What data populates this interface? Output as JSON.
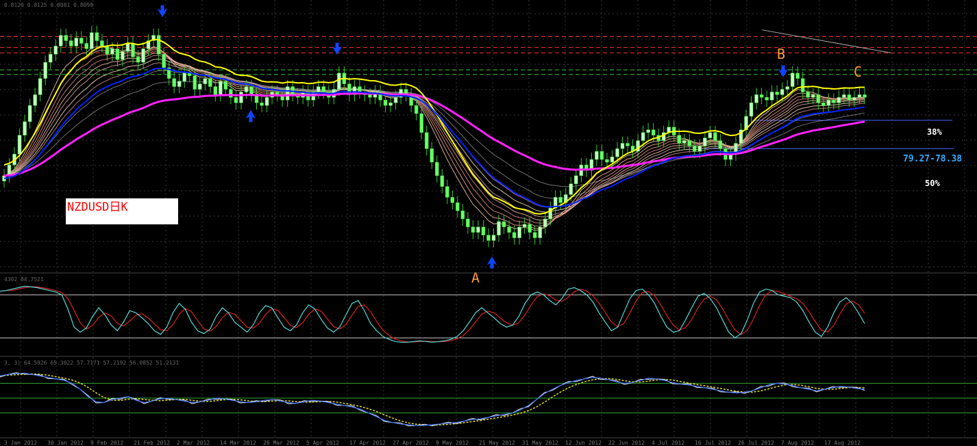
{
  "chart_data": [
    {
      "type": "candlestick",
      "symbol_label": "NZDUSD日K",
      "header_text": "0.8120 0.8125 0.8081 0.8098",
      "x_tick_labels": [
        "3 Jan 2012",
        "30 Jan 2012",
        "9 Feb 2012",
        "21 Feb 2012",
        "2 Mar 2012",
        "14 Mar 2012",
        "26 Mar 2012",
        "5 Apr 2012",
        "17 Apr 2012",
        "27 Apr 2012",
        "9 May 2012",
        "21 May 2012",
        "31 May 2012",
        "12 Jun 2012",
        "22 Jun 2012",
        "4 Jul 2012",
        "16 Jul 2012",
        "26 Jul 2012",
        "7 Aug 2012",
        "17 Aug 2012"
      ],
      "annotations": [
        {
          "text": "A",
          "color": "#ff9a3c"
        },
        {
          "text": "B",
          "color": "#ff9a3c"
        },
        {
          "text": "C",
          "color": "#ff9a3c"
        }
      ],
      "fib_labels": {
        "level_38": "38%",
        "zone": "79.27-78.38",
        "level_50": "50%"
      },
      "candle_colors": {
        "up": "#bfffbf",
        "down": "#66ff66",
        "wick": "#33cc33"
      },
      "line_colors": {
        "ema_fast": "#0022ff",
        "ema_yellow": "#ffff00",
        "ma_magenta": "#ff22ff",
        "ribbon": "#ffb090"
      },
      "closes": [
        0.77,
        0.774,
        0.778,
        0.785,
        0.79,
        0.796,
        0.8,
        0.806,
        0.812,
        0.815,
        0.818,
        0.822,
        0.82,
        0.818,
        0.821,
        0.819,
        0.817,
        0.823,
        0.82,
        0.818,
        0.815,
        0.817,
        0.813,
        0.816,
        0.819,
        0.814,
        0.812,
        0.817,
        0.82,
        0.822,
        0.815,
        0.81,
        0.806,
        0.803,
        0.805,
        0.808,
        0.807,
        0.802,
        0.804,
        0.806,
        0.803,
        0.8,
        0.805,
        0.802,
        0.799,
        0.797,
        0.801,
        0.803,
        0.8,
        0.797,
        0.796,
        0.799,
        0.801,
        0.8,
        0.798,
        0.803,
        0.8,
        0.799,
        0.801,
        0.798,
        0.801,
        0.803,
        0.801,
        0.799,
        0.802,
        0.808,
        0.804,
        0.8,
        0.803,
        0.801,
        0.8,
        0.799,
        0.801,
        0.798,
        0.796,
        0.797,
        0.799,
        0.802,
        0.8,
        0.796,
        0.793,
        0.786,
        0.78,
        0.775,
        0.77,
        0.766,
        0.762,
        0.76,
        0.757,
        0.754,
        0.751,
        0.749,
        0.751,
        0.748,
        0.746,
        0.748,
        0.753,
        0.751,
        0.749,
        0.747,
        0.751,
        0.752,
        0.749,
        0.747,
        0.751,
        0.754,
        0.758,
        0.762,
        0.76,
        0.763,
        0.767,
        0.77,
        0.774,
        0.772,
        0.776,
        0.779,
        0.776,
        0.775,
        0.777,
        0.78,
        0.782,
        0.781,
        0.779,
        0.783,
        0.786,
        0.787,
        0.785,
        0.783,
        0.786,
        0.788,
        0.785,
        0.782,
        0.783,
        0.781,
        0.779,
        0.781,
        0.784,
        0.786,
        0.783,
        0.78,
        0.776,
        0.778,
        0.782,
        0.787,
        0.792,
        0.797,
        0.8,
        0.799,
        0.798,
        0.801,
        0.8,
        0.802,
        0.803,
        0.808,
        0.806,
        0.801,
        0.799,
        0.8,
        0.797,
        0.796,
        0.798,
        0.797,
        0.799,
        0.8,
        0.798,
        0.799,
        0.8,
        0.799
      ]
    },
    {
      "type": "line",
      "header_text": "4302 84.7521",
      "levels": [
        80,
        20
      ],
      "series_colors": {
        "main": "#55dddd",
        "signal": "#dd2222"
      },
      "main": [
        85,
        86,
        88,
        90,
        92,
        91,
        90,
        88,
        86,
        84,
        80,
        60,
        35,
        28,
        34,
        50,
        62,
        52,
        38,
        30,
        42,
        58,
        55,
        48,
        40,
        30,
        25,
        35,
        55,
        68,
        60,
        42,
        30,
        26,
        32,
        50,
        62,
        55,
        42,
        35,
        28,
        38,
        55,
        65,
        62,
        48,
        35,
        30,
        38,
        55,
        66,
        60,
        46,
        34,
        28,
        35,
        52,
        68,
        72,
        58,
        40,
        30,
        22,
        18,
        15,
        14,
        14,
        15,
        16,
        15,
        14,
        15,
        16,
        18,
        22,
        30,
        42,
        55,
        62,
        55,
        48,
        40,
        35,
        38,
        50,
        68,
        80,
        84,
        80,
        72,
        66,
        75,
        88,
        90,
        86,
        80,
        70,
        55,
        42,
        30,
        35,
        55,
        75,
        86,
        88,
        80,
        68,
        50,
        35,
        28,
        30,
        45,
        62,
        78,
        82,
        75,
        62,
        45,
        28,
        20,
        26,
        45,
        68,
        84,
        88,
        86,
        80,
        78,
        76,
        70,
        58,
        42,
        28,
        22,
        35,
        55,
        70,
        76,
        68,
        55,
        40
      ]
    },
    {
      "type": "line",
      "header_text": "3, 3) 64.5926 65.3022 57.7171 57.2192 56.0852 51.2131",
      "series_colors": {
        "blue": "#4477ff",
        "white": "#f0f0f0",
        "yellow": "#dddd22",
        "green": "#33aa33"
      },
      "main": [
        80,
        82,
        83,
        84,
        82,
        80,
        78,
        76,
        74,
        70,
        62,
        52,
        45,
        44,
        48,
        50,
        52,
        47,
        44,
        46,
        49,
        50,
        48,
        46,
        44,
        45,
        47,
        50,
        49,
        47,
        45,
        44,
        45,
        47,
        48,
        46,
        44,
        43,
        45,
        47,
        46,
        44,
        42,
        40,
        38,
        35,
        30,
        25,
        20,
        17,
        15,
        14,
        13,
        13,
        14,
        15,
        16,
        17,
        19,
        21,
        22,
        24,
        26,
        28,
        30,
        34,
        40,
        48,
        56,
        62,
        67,
        71,
        74,
        76,
        78,
        77,
        75,
        72,
        70,
        71,
        74,
        77,
        76,
        74,
        71,
        69,
        68,
        66,
        64,
        62,
        60,
        58,
        57,
        58,
        60,
        64,
        68,
        70,
        69,
        67,
        64,
        62,
        60,
        62,
        64,
        66,
        65,
        63,
        62
      ]
    }
  ]
}
